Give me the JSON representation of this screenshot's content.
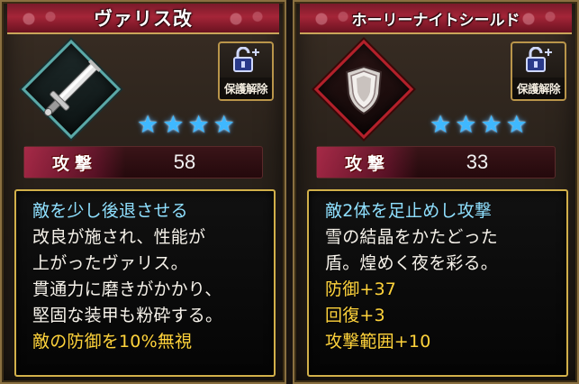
{
  "cards": [
    {
      "title": "ヴァリス改",
      "lock_label": "保護解除",
      "lock_icon": "unlock-icon",
      "item_icon": "sword-icon",
      "rarity_stars": 4,
      "stat": {
        "label": "攻撃",
        "value": "58"
      },
      "skill": "敵を少し後退させる",
      "flavor": [
        "改良が施され、性能が",
        "上がったヴァリス。",
        "貫通力に磨きがかかり、",
        "堅固な装甲も粉砕する。"
      ],
      "bonuses": [
        "敵の防御を10%無視"
      ]
    },
    {
      "title": "ホーリーナイトシールド",
      "lock_label": "保護解除",
      "lock_icon": "unlock-icon",
      "item_icon": "shield-icon",
      "rarity_stars": 4,
      "stat": {
        "label": "攻撃",
        "value": "33"
      },
      "skill": "敵2体を足止めし攻撃",
      "flavor": [
        "雪の結晶をかたどった",
        "盾。煌めく夜を彩る。"
      ],
      "bonuses": [
        "防御+37",
        "回復+3",
        "攻撃範囲+10"
      ]
    }
  ],
  "colors": {
    "skill_text": "#8fe0ff",
    "flavor_text": "#f6f2ea",
    "bonus_text": "#ffd33b",
    "title_bar": "#a52538",
    "star": "#3fb8ff",
    "sword_frame": "#5aa9a8",
    "shield_frame": "#b4202a"
  }
}
